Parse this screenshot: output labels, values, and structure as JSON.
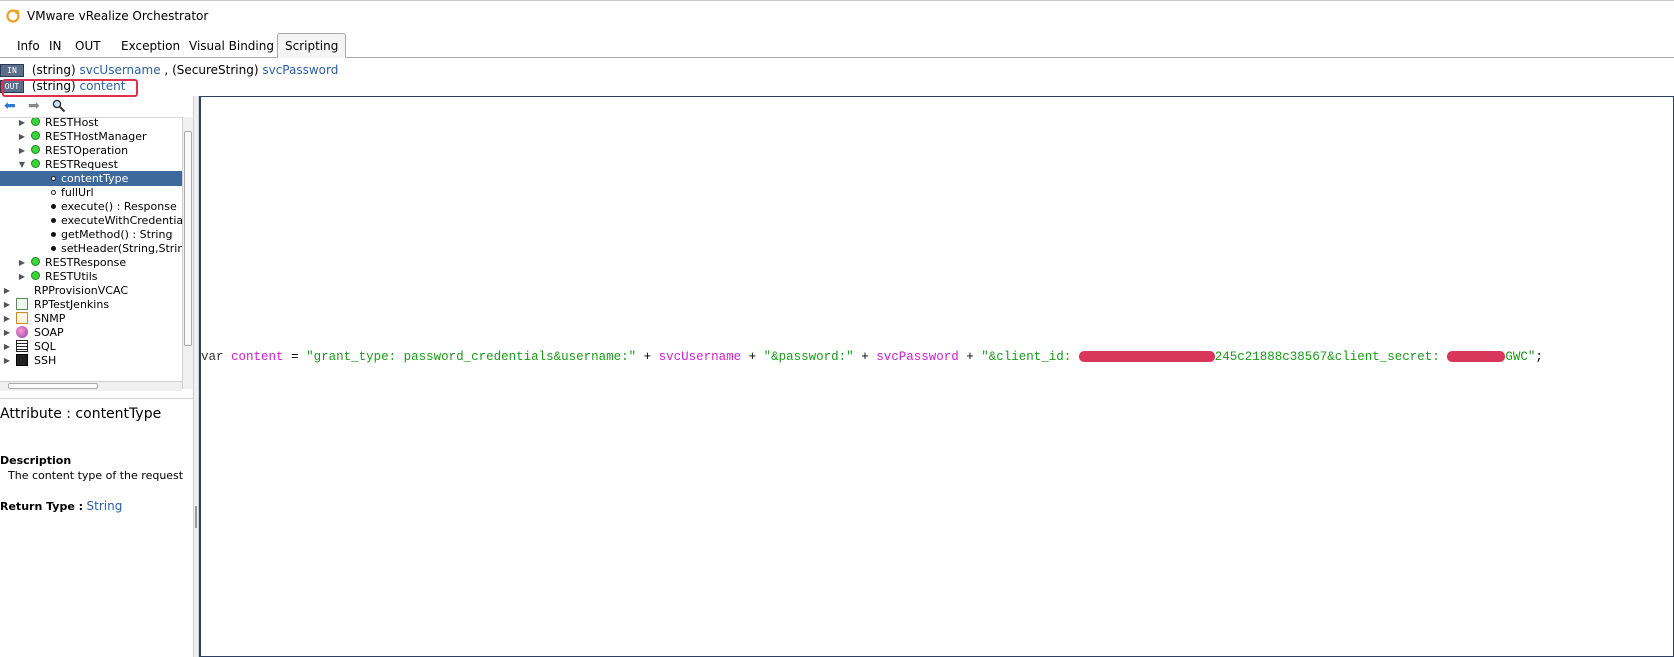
{
  "window": {
    "title": "VMware vRealize Orchestrator"
  },
  "tabs": [
    "Info",
    "IN",
    "OUT",
    "Exception",
    "Visual Binding",
    "Scripting"
  ],
  "active_tab": "Scripting",
  "params": {
    "in_badge": "IN",
    "out_badge": "OUT",
    "in_line": [
      {
        "type": "(string)",
        "name": "svcUsername",
        "sep": ","
      },
      {
        "type": "(SecureString)",
        "name": "svcPassword",
        "sep": ""
      }
    ],
    "out_line": {
      "type": "(string)",
      "name": "content"
    }
  },
  "tree": {
    "items": [
      {
        "label": "RESTHost",
        "kind": "class",
        "level": 1,
        "arrow": "▶"
      },
      {
        "label": "RESTHostManager",
        "kind": "class",
        "level": 1,
        "arrow": "▶"
      },
      {
        "label": "RESTOperation",
        "kind": "class",
        "level": 1,
        "arrow": "▶"
      },
      {
        "label": "RESTRequest",
        "kind": "class",
        "level": 1,
        "arrow": "▼"
      },
      {
        "label": "contentType",
        "kind": "attribute",
        "level": 2,
        "selected": true
      },
      {
        "label": "fullUrl",
        "kind": "attribute",
        "level": 2
      },
      {
        "label": "execute() : Response",
        "kind": "method",
        "level": 2
      },
      {
        "label": "executeWithCredentials(S",
        "kind": "method",
        "level": 2
      },
      {
        "label": "getMethod() : String",
        "kind": "method",
        "level": 2
      },
      {
        "label": "setHeader(String,String)",
        "kind": "method",
        "level": 2
      },
      {
        "label": "RESTResponse",
        "kind": "class",
        "level": 1,
        "arrow": "▶"
      },
      {
        "label": "RESTUtils",
        "kind": "class",
        "level": 1,
        "arrow": "▶"
      },
      {
        "label": "RPProvisionVCAC",
        "kind": "package",
        "level": 0,
        "arrow": "▶"
      },
      {
        "label": "RPTestJenkins",
        "kind": "package",
        "level": 0,
        "arrow": "▶",
        "icon": "clipboard-icon"
      },
      {
        "label": "SNMP",
        "kind": "package",
        "level": 0,
        "arrow": "▶",
        "icon": "list-icon"
      },
      {
        "label": "SOAP",
        "kind": "package",
        "level": 0,
        "arrow": "▶",
        "icon": "globe-icon"
      },
      {
        "label": "SQL",
        "kind": "package",
        "level": 0,
        "arrow": "▶",
        "icon": "database-icon"
      },
      {
        "label": "SSH",
        "kind": "package",
        "level": 0,
        "arrow": "▶",
        "icon": "terminal-icon"
      }
    ]
  },
  "info": {
    "attribute_title": "Attribute : contentType",
    "description_heading": "Description",
    "description_text": "The content type of the request",
    "return_label": "Return Type :",
    "return_value": "String"
  },
  "editor": {
    "code": {
      "kw": "var",
      "var1": "content",
      "eq": " = ",
      "s1": "\"grant_type: password_credentials&username:\"",
      "plus1": " + ",
      "v2": "svcUsername",
      "plus2": " + ",
      "s2": "\"&password:\"",
      "plus3": " + ",
      "v3": "svcPassword",
      "plus4": " + ",
      "s3a": "\"&client_id: ",
      "s3b": "245c21888c38567&client_secret: ",
      "s3c": "GWC\"",
      "end": ";"
    }
  },
  "colors": {
    "accent": "#3d6a9a",
    "highlight": "#e0304e",
    "string": "#1a9a1a",
    "variable": "#d020d0"
  }
}
